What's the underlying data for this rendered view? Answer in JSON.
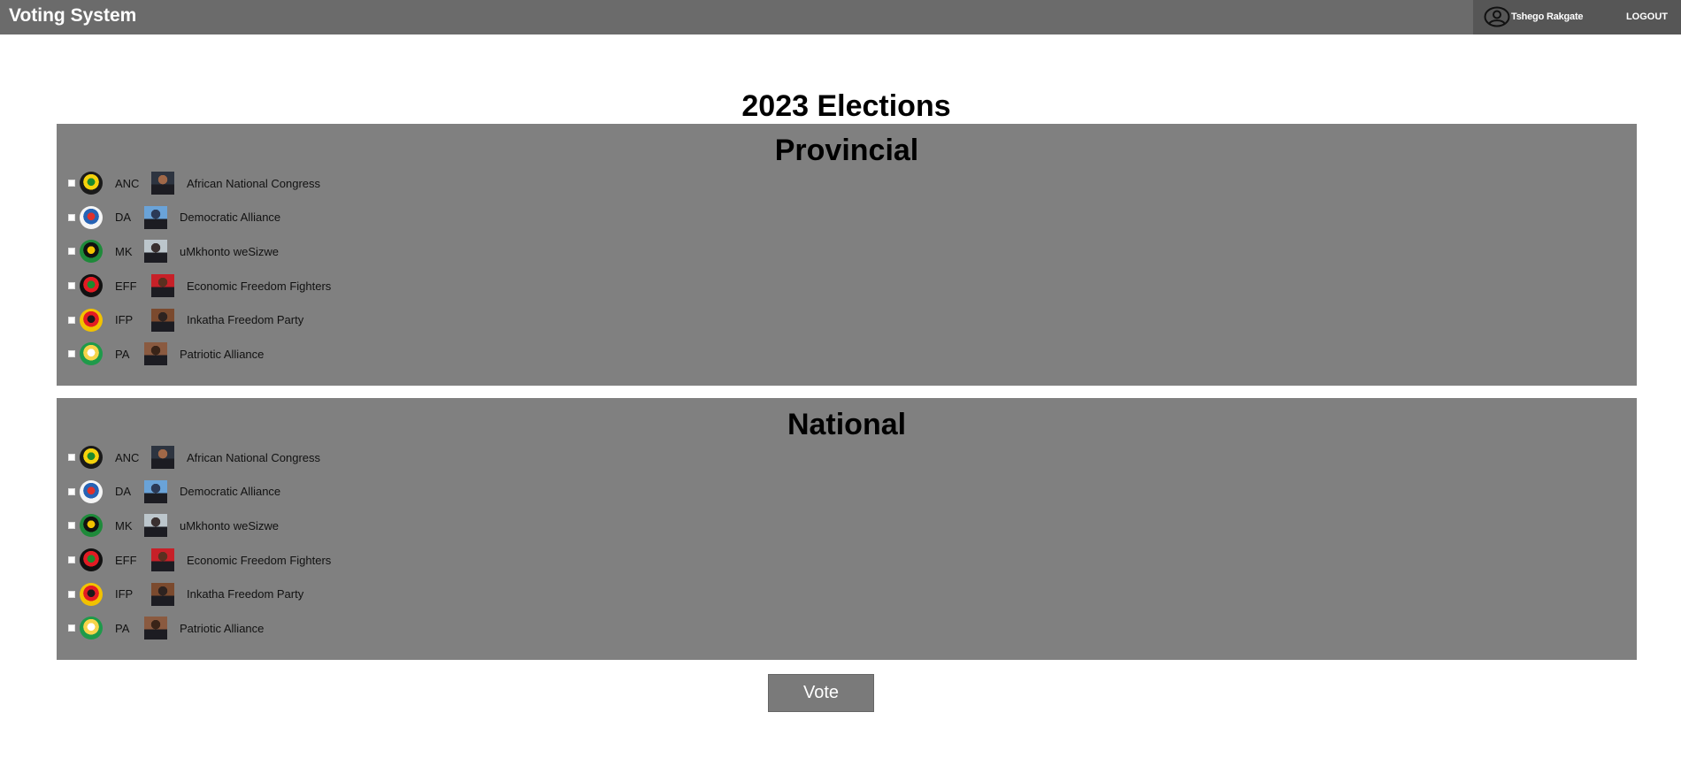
{
  "header": {
    "app_title": "Voting System",
    "user_name": "Tshego Rakgate",
    "logout_label": "LOGOUT"
  },
  "page_title": "2023 Elections",
  "sections": [
    {
      "title": "Provincial",
      "parties": [
        {
          "abbr": "ANC",
          "name": "African National Congress",
          "logo_colors": [
            "#1a1a1a",
            "#f5d20c",
            "#1c8a2e"
          ],
          "photo_colors": [
            "#2d3440",
            "#a06848"
          ]
        },
        {
          "abbr": "DA",
          "name": "Democratic Alliance",
          "logo_colors": [
            "#f5f5f5",
            "#2663b5",
            "#e0312b"
          ],
          "photo_colors": [
            "#6aa3d8",
            "#2b3a57"
          ]
        },
        {
          "abbr": "MK",
          "name": "uMkhonto weSizwe",
          "logo_colors": [
            "#1e8a3a",
            "#111111",
            "#f2c200"
          ],
          "photo_colors": [
            "#bcc6cc",
            "#3a3030"
          ]
        },
        {
          "abbr": "EFF",
          "name": "Economic Freedom Fighters",
          "logo_colors": [
            "#111111",
            "#e31b23",
            "#1c8a2e"
          ],
          "photo_colors": [
            "#c72028",
            "#5a3020"
          ]
        },
        {
          "abbr": "IFP",
          "name": "Inkatha Freedom Party",
          "logo_colors": [
            "#f2c200",
            "#e31b23",
            "#1a1a1a"
          ],
          "photo_colors": [
            "#7b4a2e",
            "#2e2320"
          ]
        },
        {
          "abbr": "PA",
          "name": "Patriotic Alliance",
          "logo_colors": [
            "#1e9a4a",
            "#f7d44a",
            "#ffffff"
          ],
          "photo_colors": [
            "#8a5a40",
            "#3a2418"
          ]
        }
      ]
    },
    {
      "title": "National",
      "parties": [
        {
          "abbr": "ANC",
          "name": "African National Congress",
          "logo_colors": [
            "#1a1a1a",
            "#f5d20c",
            "#1c8a2e"
          ],
          "photo_colors": [
            "#2d3440",
            "#a06848"
          ]
        },
        {
          "abbr": "DA",
          "name": "Democratic Alliance",
          "logo_colors": [
            "#f5f5f5",
            "#2663b5",
            "#e0312b"
          ],
          "photo_colors": [
            "#6aa3d8",
            "#2b3a57"
          ]
        },
        {
          "abbr": "MK",
          "name": "uMkhonto weSizwe",
          "logo_colors": [
            "#1e8a3a",
            "#111111",
            "#f2c200"
          ],
          "photo_colors": [
            "#bcc6cc",
            "#3a3030"
          ]
        },
        {
          "abbr": "EFF",
          "name": "Economic Freedom Fighters",
          "logo_colors": [
            "#111111",
            "#e31b23",
            "#1c8a2e"
          ],
          "photo_colors": [
            "#c72028",
            "#5a3020"
          ]
        },
        {
          "abbr": "IFP",
          "name": "Inkatha Freedom Party",
          "logo_colors": [
            "#f2c200",
            "#e31b23",
            "#1a1a1a"
          ],
          "photo_colors": [
            "#7b4a2e",
            "#2e2320"
          ]
        },
        {
          "abbr": "PA",
          "name": "Patriotic Alliance",
          "logo_colors": [
            "#1e9a4a",
            "#f7d44a",
            "#ffffff"
          ],
          "photo_colors": [
            "#8a5a40",
            "#3a2418"
          ]
        }
      ]
    }
  ],
  "vote_label": "Vote"
}
